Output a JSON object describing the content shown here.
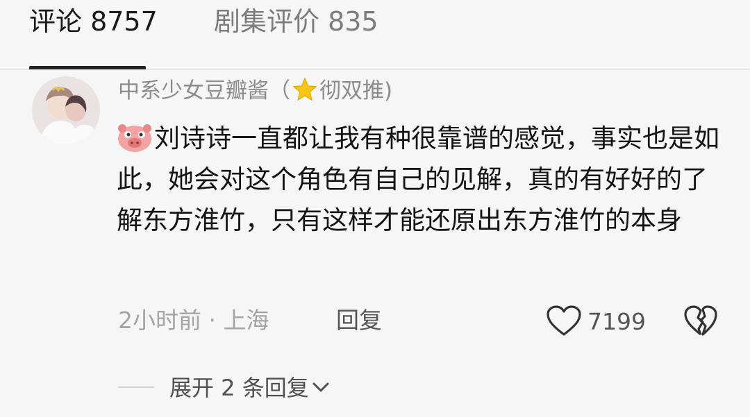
{
  "tabs": [
    {
      "label": "评论 8757"
    },
    {
      "label": "剧集评价 835"
    }
  ],
  "comment": {
    "user_name": "中系少女豆瓣酱",
    "user_badge_open": "（",
    "user_badge_text": "彻双推)",
    "avatar_icon": "avatar-image",
    "emoji_icon": "pig-face-icon",
    "text": "刘诗诗一直都让我有种很靠谱的感觉，事实也是如此，她会对这个角色有自己的见解，真的有好好的了解东方淮竹，只有这样才能还原出东方淮竹的本身",
    "time_location": "2小时前 · 上海",
    "reply_label": "回复",
    "like_count": "7199",
    "expand_label": "展开 2 条回复"
  },
  "colors": {
    "background": "#f6f6f6",
    "text_primary": "#141414",
    "text_secondary": "#8b8b8b",
    "accent_star": "#f5c518",
    "pig": "#f3a3a3"
  }
}
